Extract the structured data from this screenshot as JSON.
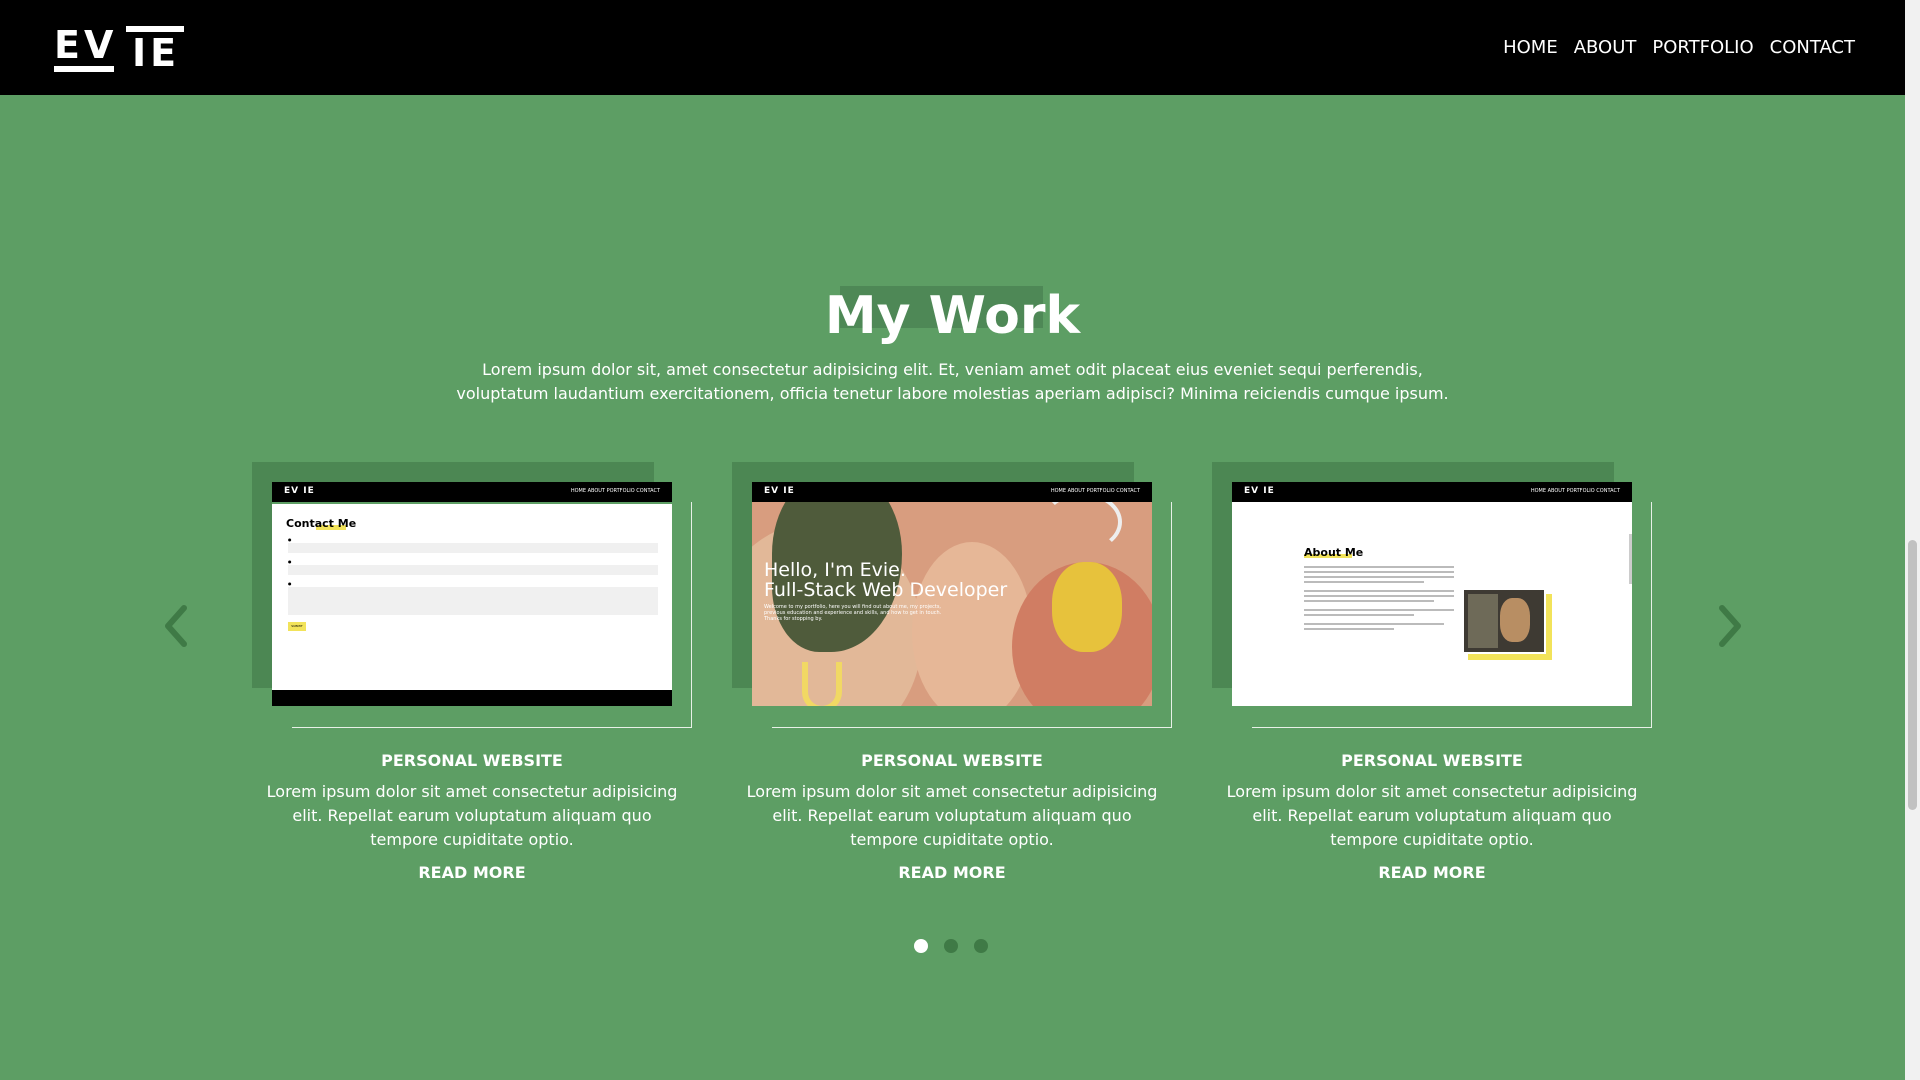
{
  "header": {
    "logo_top": "EV",
    "logo_bottom": "IE",
    "nav": [
      "HOME",
      "ABOUT",
      "PORTFOLIO",
      "CONTACT"
    ]
  },
  "section": {
    "title": "My Work",
    "intro": "Lorem ipsum dolor sit, amet consectetur adipisicing elit. Et, veniam amet odit placeat eius eveniet sequi perferendis, voluptatum laudantium exercitationem, officia tenetur labore molestias aperiam adipisci? Minima reiciendis cumque ipsum."
  },
  "cards": [
    {
      "title": "PERSONAL WEBSITE",
      "description": "Lorem ipsum dolor sit amet consectetur adipisicing elit. Repellat earum voluptatum aliquam quo tempore cupiditate optio.",
      "read_more": "READ MORE",
      "preview": {
        "logo": "EV IE",
        "links": "HOME  ABOUT  PORTFOLIO  CONTACT",
        "heading": "Contact Me",
        "submit": "SUBMIT"
      }
    },
    {
      "title": "PERSONAL WEBSITE",
      "description": "Lorem ipsum dolor sit amet consectetur adipisicing elit. Repellat earum voluptatum aliquam quo tempore cupiditate optio.",
      "read_more": "READ MORE",
      "preview": {
        "logo": "EV IE",
        "links": "HOME  ABOUT  PORTFOLIO  CONTACT",
        "hero_line1": "Hello, I'm Evie.",
        "hero_line2": "Full-Stack Web Developer",
        "sub": "Welcome to my portfolio, here you will find out about me, my projects, previous education and experience and skills, and how to get in touch. Thanks for stopping by."
      }
    },
    {
      "title": "PERSONAL WEBSITE",
      "description": "Lorem ipsum dolor sit amet consectetur adipisicing elit. Repellat earum voluptatum aliquam quo tempore cupiditate optio.",
      "read_more": "READ MORE",
      "preview": {
        "logo": "EV IE",
        "links": "HOME  ABOUT  PORTFOLIO  CONTACT",
        "heading": "About Me"
      }
    }
  ],
  "carousel": {
    "prev_icon": "chevron-left-icon",
    "next_icon": "chevron-right-icon",
    "total_slides": 3,
    "active_slide": 1
  },
  "colors": {
    "background": "#5d9e64",
    "header": "#000000",
    "card_shadow": "#4c8753",
    "accent_yellow": "#f2e35a"
  }
}
